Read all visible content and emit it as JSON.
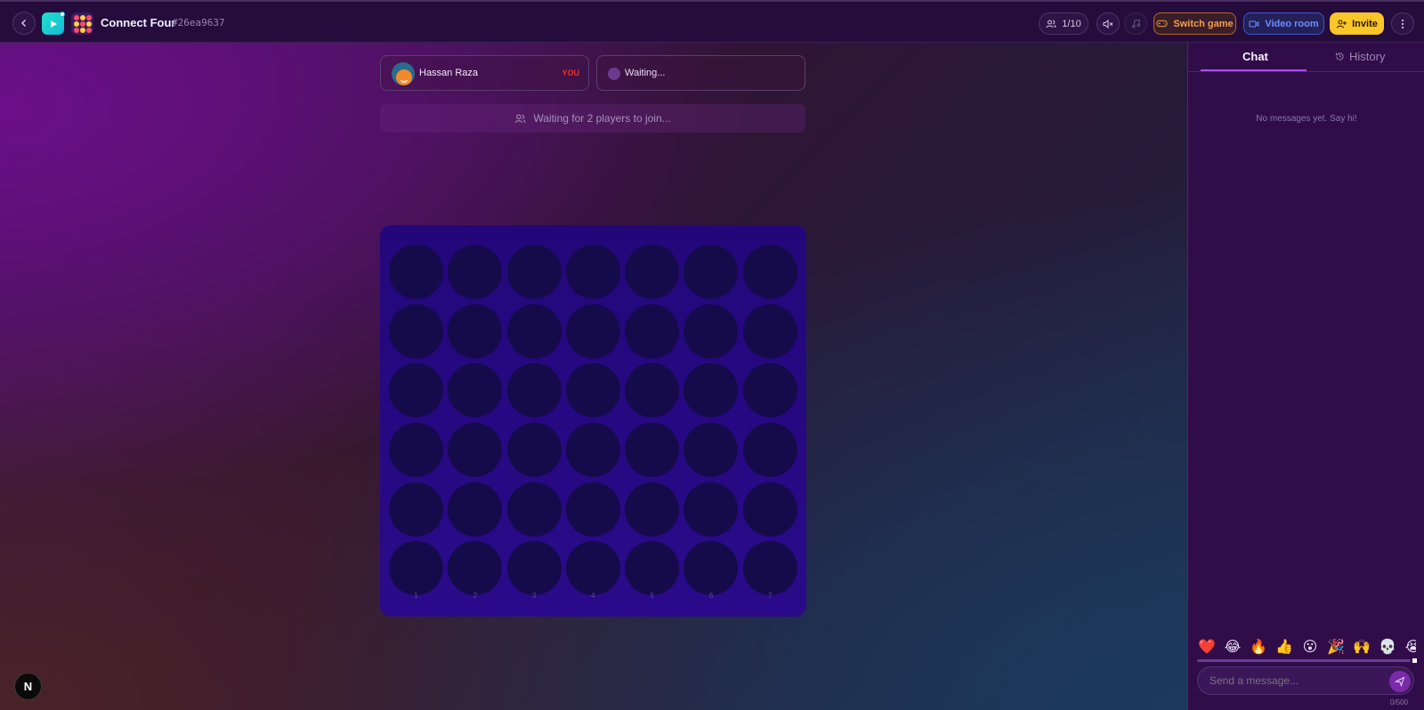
{
  "header": {
    "title": "Connect Four",
    "room_id": "#26ea9637",
    "players_count": "1/10",
    "switch_game": "Switch game",
    "video_room": "Video room",
    "invite": "Invite"
  },
  "players": [
    {
      "name": "Hassan Raza",
      "badge": "YOU"
    },
    {
      "name": "Waiting..."
    }
  ],
  "status": {
    "waiting_text": "Waiting for 2 players to join..."
  },
  "board": {
    "rows": 6,
    "columns": 7,
    "column_labels": [
      "1",
      "2",
      "3",
      "4",
      "5",
      "6",
      "7"
    ]
  },
  "sidebar": {
    "tabs": {
      "chat": "Chat",
      "history": "History"
    },
    "active_tab": "chat",
    "empty_message": "No messages yet. Say hi!",
    "emojis": [
      "❤️",
      "😂",
      "🔥",
      "👍",
      "😮",
      "🎉",
      "🙌",
      "💀",
      "😭",
      "😅"
    ],
    "input_placeholder": "Send a message...",
    "char_count": "0/500"
  },
  "colors": {
    "accent_purple": "#a74dff",
    "invite_yellow": "#fbc628",
    "switch_orange": "#f2a04a",
    "video_blue": "#6f8dff",
    "board_blue": "#23077a",
    "you_red": "#e8332a"
  },
  "dev_badge": "N"
}
